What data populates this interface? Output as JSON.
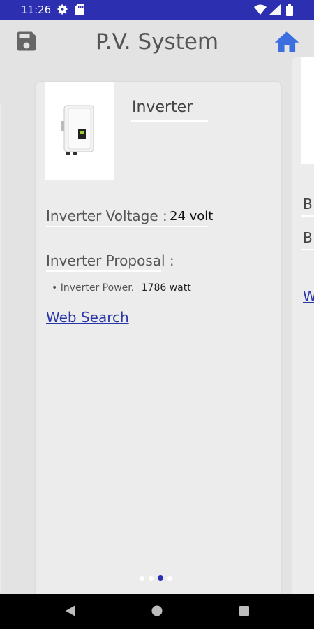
{
  "status": {
    "time": "11:26"
  },
  "header": {
    "title": "P.V. System"
  },
  "card": {
    "title": "Inverter",
    "voltage_label": "Inverter Voltage :",
    "voltage_value": "24 volt",
    "proposal_label": "Inverter Proposal :",
    "power_label": "Inverter Power.",
    "power_value": "1786 watt",
    "web_search": "Web Search"
  },
  "pager": {
    "count": 4,
    "active_index": 2
  },
  "peek_card": {
    "line1": "B",
    "line2": "B",
    "link": "W"
  }
}
